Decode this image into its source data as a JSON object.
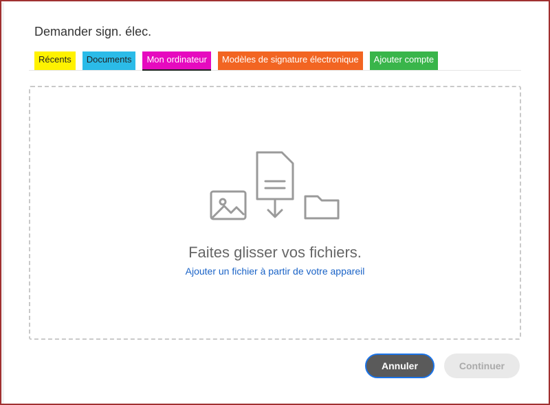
{
  "dialog": {
    "title": "Demander sign. élec."
  },
  "tabs": {
    "recents": "Récents",
    "documents": "Documents",
    "computer": "Mon ordinateur",
    "templates": "Modèles de signature électronique",
    "add_account": "Ajouter compte"
  },
  "dropzone": {
    "title": "Faites glisser vos fichiers.",
    "link": "Ajouter un fichier à partir de votre appareil"
  },
  "buttons": {
    "cancel": "Annuler",
    "continue": "Continuer"
  }
}
